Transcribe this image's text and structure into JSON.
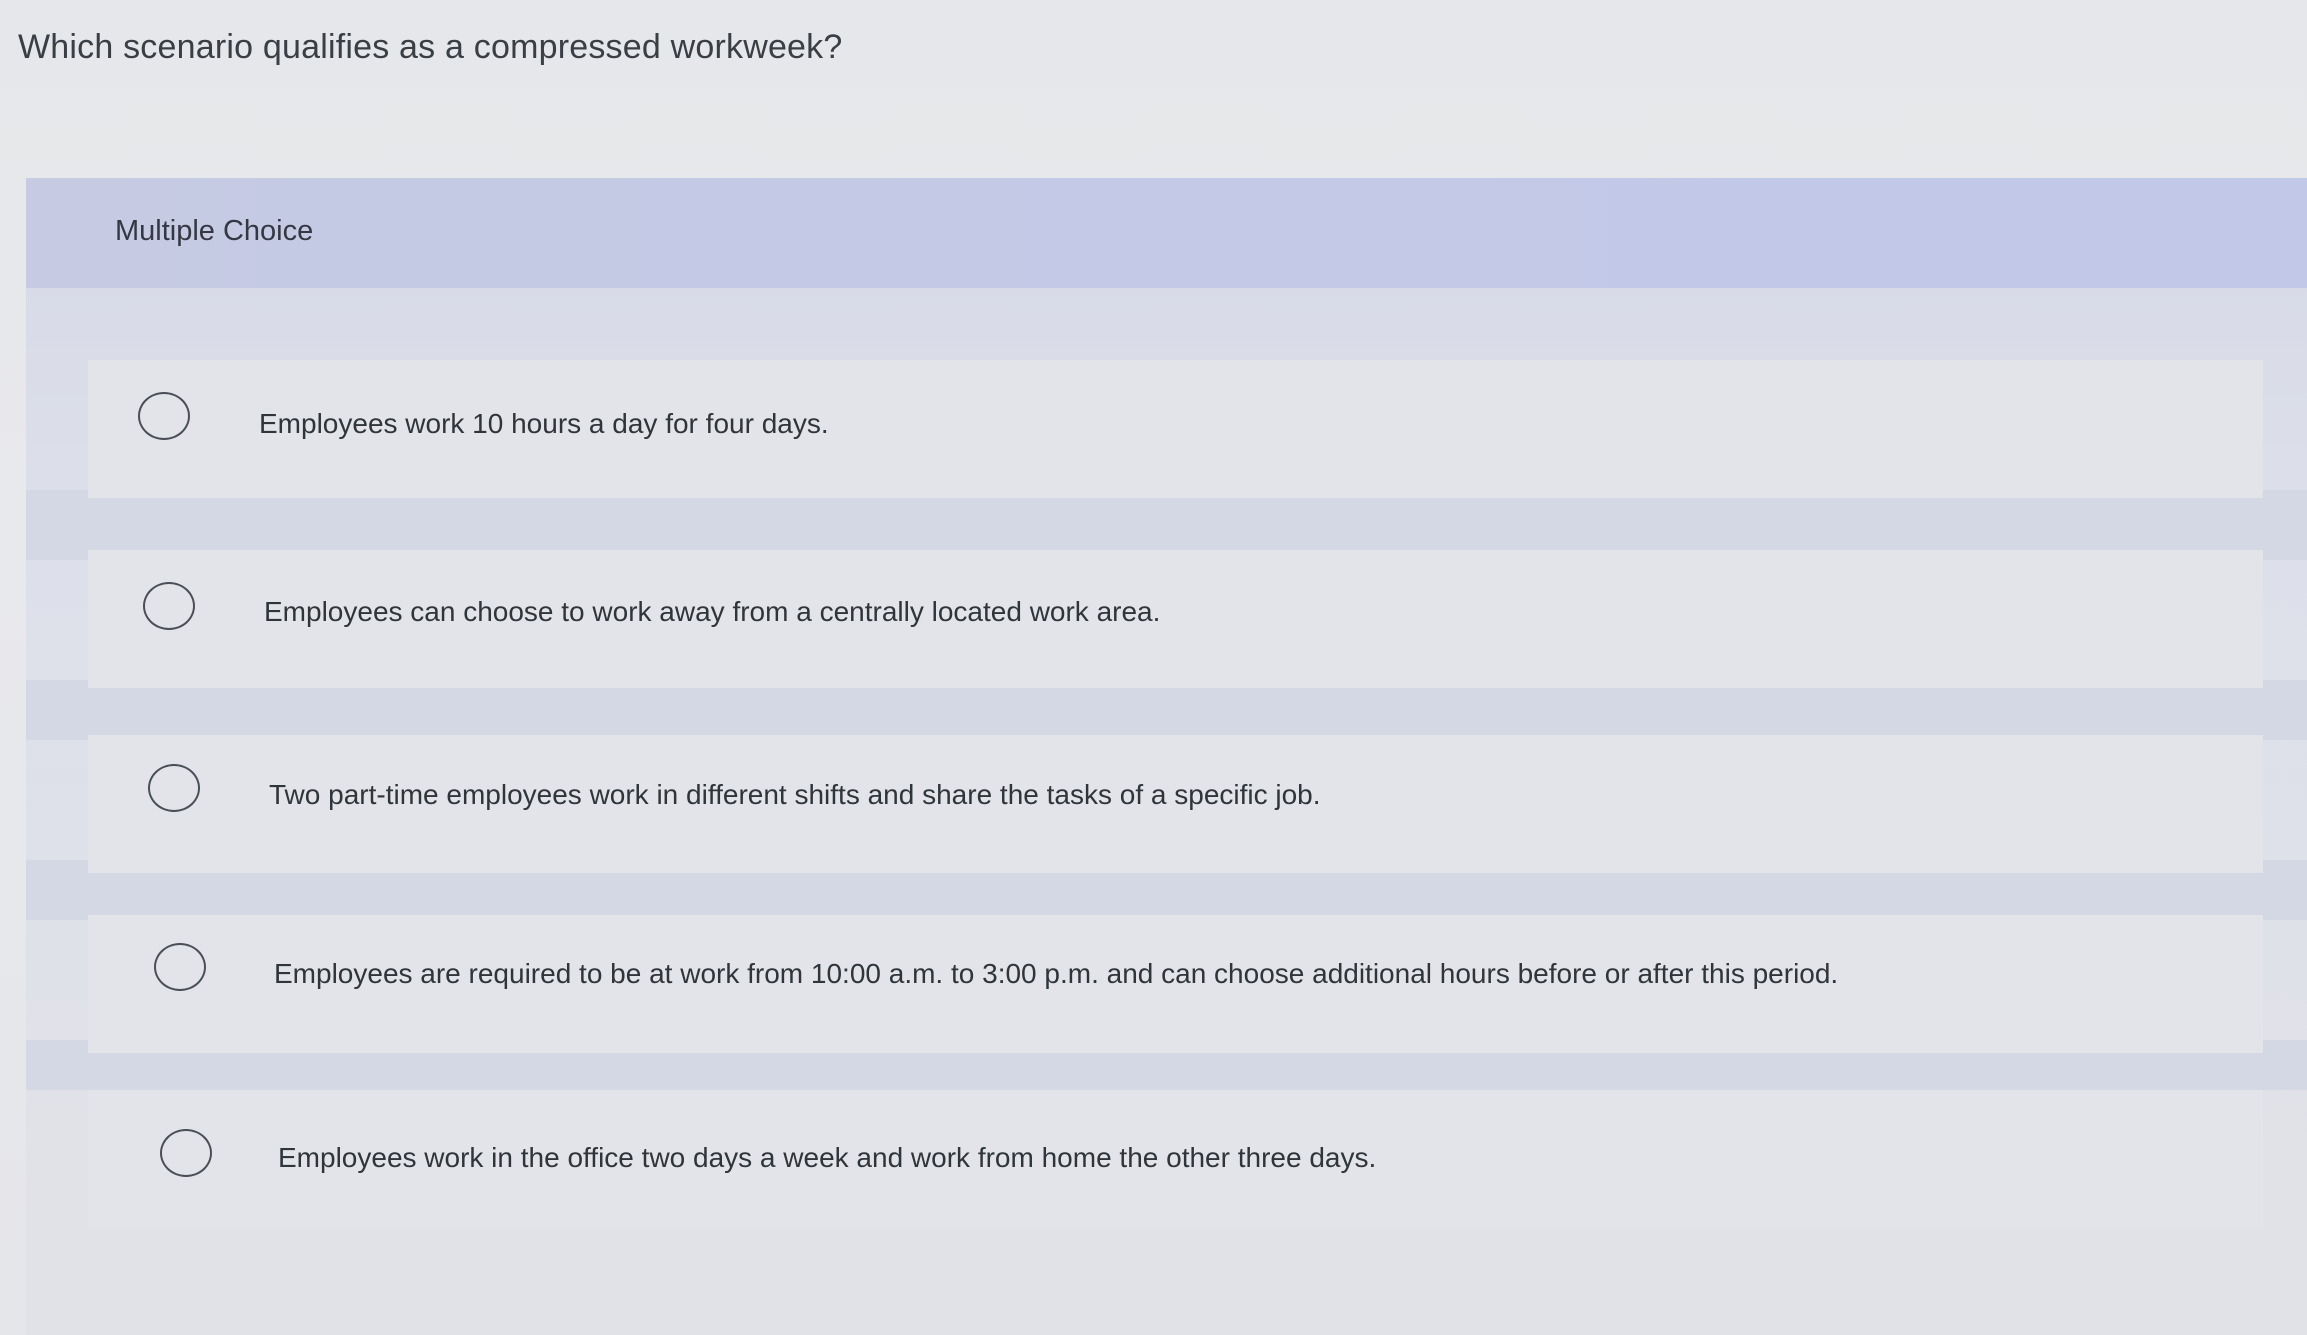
{
  "question": {
    "text": "Which scenario qualifies as a compressed workweek?"
  },
  "panel": {
    "type_label": "Multiple Choice"
  },
  "options": [
    {
      "label": "Employees work 10 hours a day for four days.",
      "selected": false
    },
    {
      "label": "Employees can choose to work away from a centrally located work area.",
      "selected": false
    },
    {
      "label": "Two part-time employees work in different shifts and share the tasks of a specific job.",
      "selected": false
    },
    {
      "label": "Employees are required to be at work from 10:00 a.m. to 3:00 p.m. and can choose additional hours before or after this period.",
      "selected": false
    },
    {
      "label": "Employees work in the office two days a week and work from home the other three days.",
      "selected": false
    }
  ],
  "colors": {
    "header_band": "#c3c9e6",
    "page_background": "#e6e7ea",
    "text": "#30343b"
  }
}
